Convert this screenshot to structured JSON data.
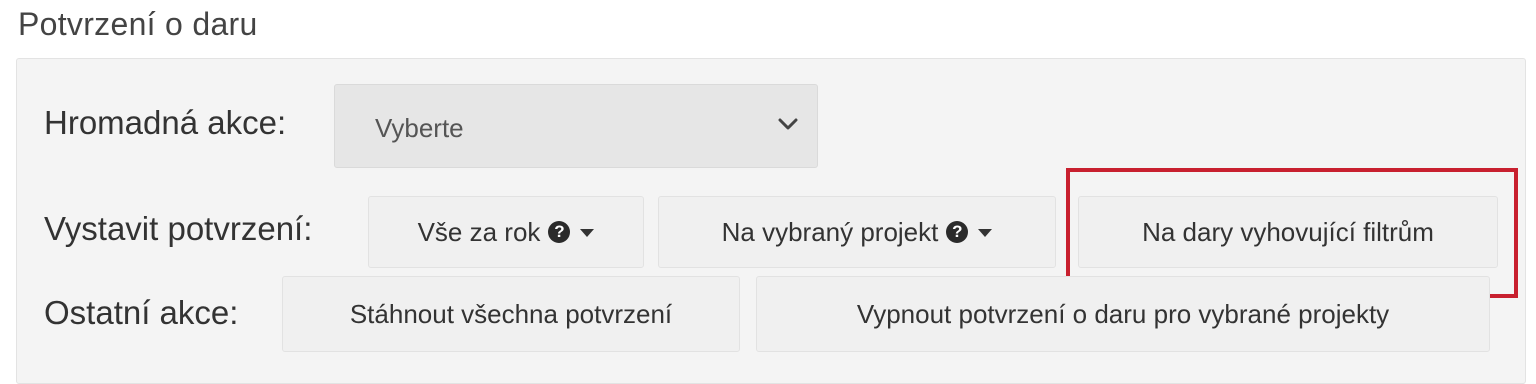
{
  "section": {
    "title": "Potvrzení o daru"
  },
  "bulk_action": {
    "label": "Hromadná akce:",
    "select_value": "Vyberte"
  },
  "issue": {
    "label": "Vystavit potvrzení:",
    "buttons": [
      {
        "label": "Vše za rok",
        "icons": [
          "question-circle-icon",
          "caret-down-icon"
        ]
      },
      {
        "label": "Na vybraný projekt",
        "icons": [
          "question-circle-icon",
          "caret-down-icon"
        ]
      },
      {
        "label": "Na dary vyhovující filtrům",
        "highlighted": true
      }
    ]
  },
  "other": {
    "label": "Ostatní akce:",
    "buttons": [
      {
        "label": "Stáhnout všechna potvrzení"
      },
      {
        "label": "Vypnout potvrzení o daru pro vybrané projekty"
      }
    ]
  },
  "colors": {
    "highlight_border": "#c8202f",
    "panel_background": "#f4f4f4",
    "button_background": "#f0f0f0"
  }
}
